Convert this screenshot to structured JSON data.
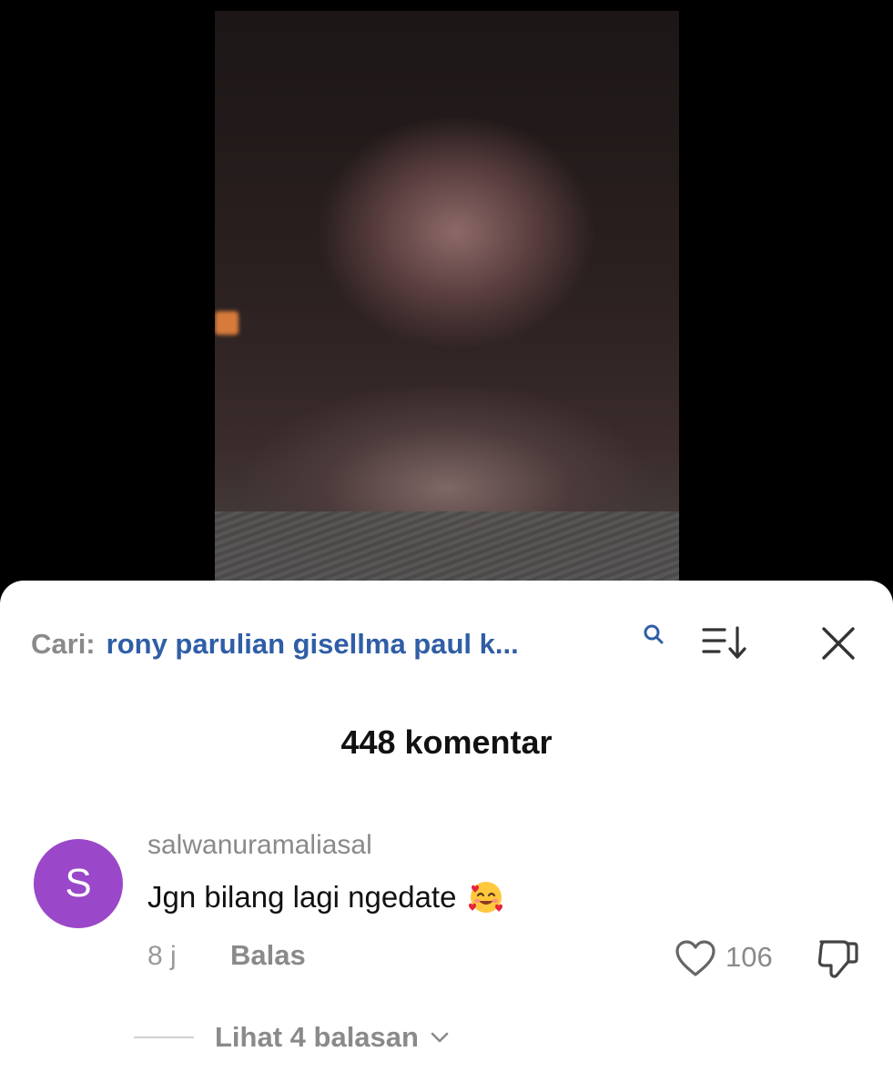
{
  "search": {
    "prefix": "Cari:",
    "query": "rony parulian gisellma paul k..."
  },
  "comments_header": {
    "title": "448 komentar"
  },
  "comment": {
    "avatar_letter": "S",
    "avatar_color": "#9a47c9",
    "username": "salwanuramaliasal",
    "text": "Jgn bilang lagi ngedate",
    "emoji": "smiling-face-with-hearts",
    "time": "8 j",
    "reply_label": "Balas",
    "like_count": "106",
    "view_replies_label": "Lihat 4 balasan"
  },
  "colors": {
    "link_blue": "#2f5ea6",
    "muted_gray": "#8a8a8a",
    "text_dark": "#111111"
  }
}
